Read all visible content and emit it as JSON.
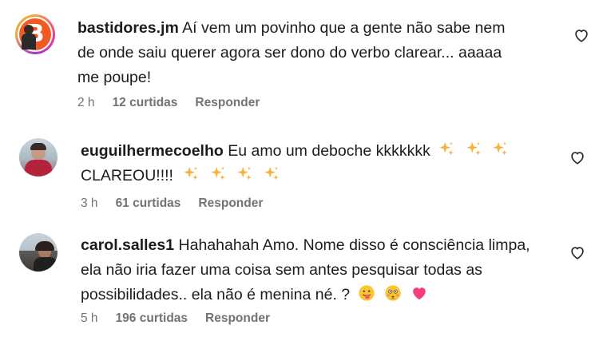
{
  "comments": [
    {
      "username": "bastidores.jm",
      "lines": [
        "Aí vem um povinho que a gente não sabe nem",
        "de onde saiu querer agora ser dono do verbo clarear... aaaaa",
        "me poupe!"
      ],
      "time": "2 h",
      "likes": "12 curtidas",
      "reply": "Responder",
      "avatar_letter": "B"
    },
    {
      "username": "euguilhermecoelho",
      "lines": [
        "Eu amo um deboche kkkkkkk",
        "CLAREOU!!!!"
      ],
      "emoji_line1": [
        "sparkles-icon",
        "sparkles-icon",
        "sparkles-icon"
      ],
      "emoji_line2": [
        "sparkles-icon",
        "sparkles-icon",
        "sparkles-icon",
        "sparkles-icon"
      ],
      "time": "3 h",
      "likes": "61 curtidas",
      "reply": "Responder"
    },
    {
      "username": "carol.salles1",
      "lines": [
        "Hahahahah Amo. Nome disso é consciência limpa,",
        "ela não iria fazer uma coisa sem antes pesquisar todas as",
        "possibilidades.. ela não é menina né. ?"
      ],
      "emoji_line3": [
        "tongue-face-icon",
        "flushed-face-icon",
        "pink-heart-icon"
      ],
      "time": "5 h",
      "likes": "196 curtidas",
      "reply": "Responder"
    }
  ],
  "colors": {
    "text": "#1c1c1c",
    "meta": "#737373",
    "brand_orange": "#f15a22",
    "heart_pink": "#f43f7a"
  }
}
